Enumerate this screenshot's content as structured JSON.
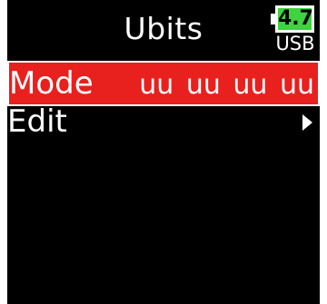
{
  "screen": {
    "title": "Ubits",
    "power": {
      "battery_level": "4.7",
      "source_label": "USB",
      "battery_color": "#3fd33f"
    }
  },
  "menu": {
    "items": [
      {
        "label": "Mode",
        "value": "uu uu uu uu",
        "selected": true
      },
      {
        "label": "Edit",
        "has_submenu": true,
        "selected": false
      }
    ],
    "highlight_color": "#e8201e"
  }
}
